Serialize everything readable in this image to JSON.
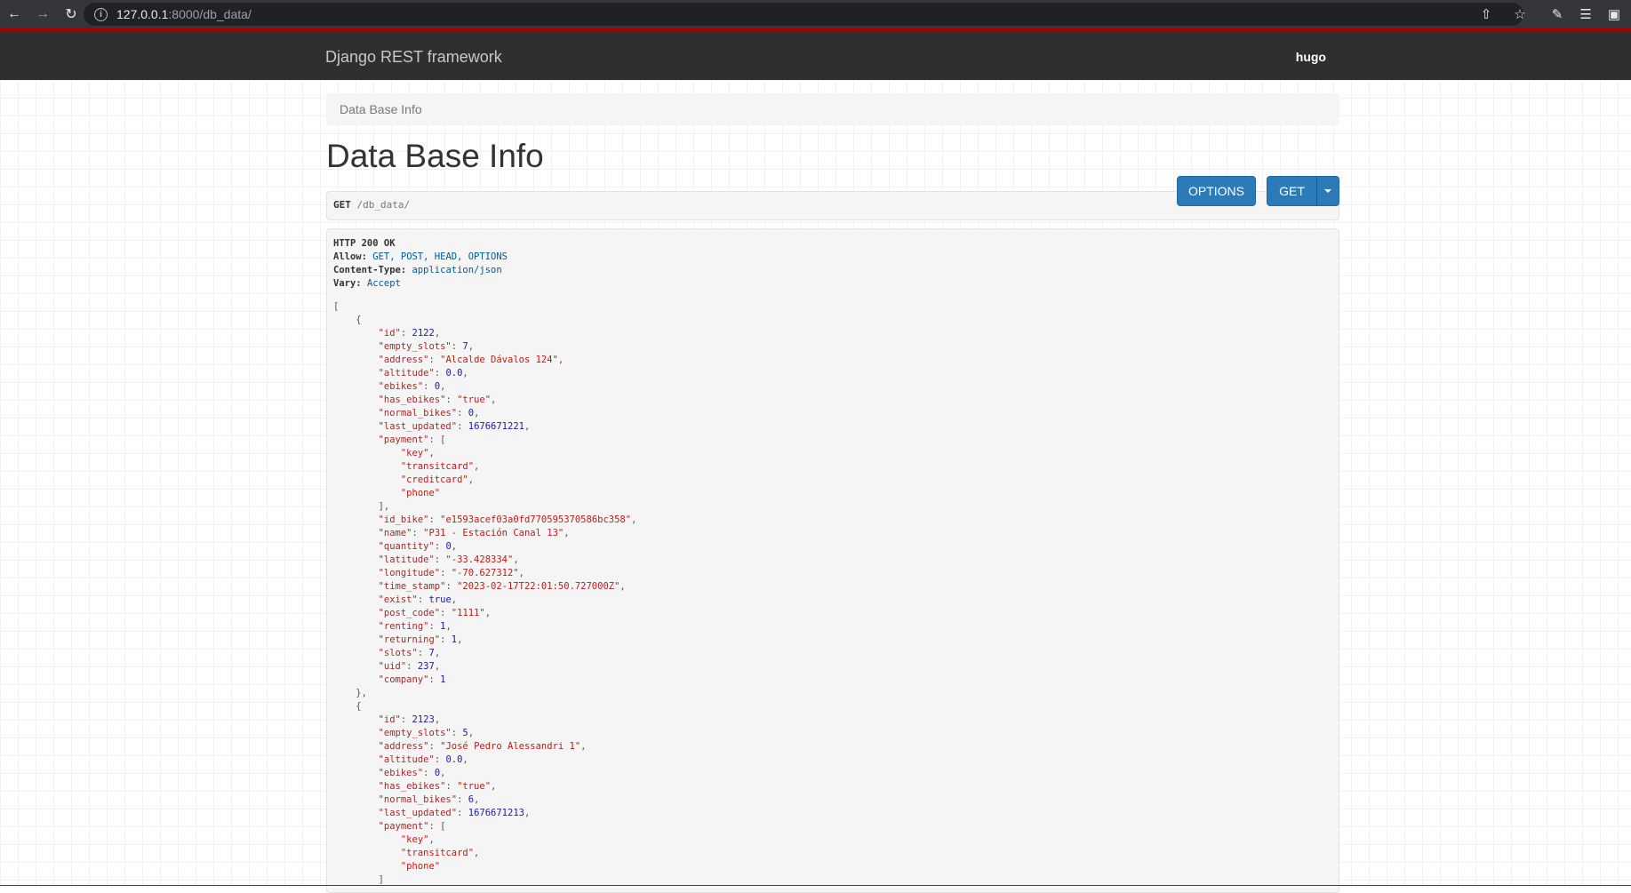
{
  "browser": {
    "url_host": "127.0.0.1",
    "url_path": ":8000/db_data/"
  },
  "navbar": {
    "brand": "Django REST framework",
    "user": "hugo"
  },
  "breadcrumb": "Data Base Info",
  "page_title": "Data Base Info",
  "buttons": {
    "options": "OPTIONS",
    "get": "GET"
  },
  "request": {
    "method": "GET",
    "path": "/db_data/"
  },
  "response_headers": {
    "status": "HTTP 200 OK",
    "allow_label": "Allow:",
    "allow_value": "GET, POST, HEAD, OPTIONS",
    "ctype_label": "Content-Type:",
    "ctype_value": "application/json",
    "vary_label": "Vary:",
    "vary_value": "Accept"
  },
  "records": [
    {
      "id": "2122",
      "empty_slots": "7",
      "address": "\"Alcalde Dávalos 124\"",
      "altitude": "0.0",
      "ebikes": "0",
      "has_ebikes": "\"true\"",
      "normal_bikes": "0",
      "last_updated": "1676671221",
      "payment": [
        "\"key\"",
        "\"transitcard\"",
        "\"creditcard\"",
        "\"phone\""
      ],
      "id_bike": "\"e1593acef03a0fd770595370586bc358\"",
      "name": "\"P31 - Estación Canal 13\"",
      "quantity": "0",
      "latitude": "\"-33.428334\"",
      "longitude": "\"-70.627312\"",
      "time_stamp": "\"2023-02-17T22:01:50.727000Z\"",
      "exist": "true",
      "post_code": "\"1111\"",
      "renting": "1",
      "returning": "1",
      "slots": "7",
      "uid": "237",
      "company": "1"
    },
    {
      "id": "2123",
      "empty_slots": "5",
      "address": "\"José Pedro Alessandri 1\"",
      "altitude": "0.0",
      "ebikes": "0",
      "has_ebikes": "\"true\"",
      "normal_bikes": "6",
      "last_updated": "1676671213",
      "payment": [
        "\"key\"",
        "\"transitcard\"",
        "\"phone\""
      ]
    }
  ]
}
